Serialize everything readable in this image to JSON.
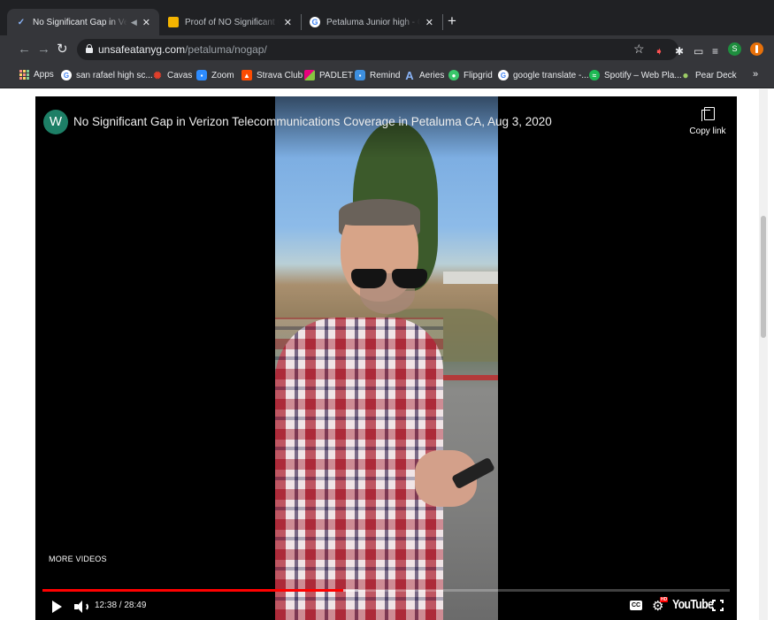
{
  "tabs": [
    {
      "title": "No Significant Gap in Verizo",
      "favicon": "checkmark-icon",
      "active": true
    },
    {
      "title": "Proof of NO Significant Gap of",
      "favicon": "slides-icon",
      "active": false
    },
    {
      "title": "Petaluma Junior high - Google",
      "favicon": "google-icon",
      "active": false
    }
  ],
  "toolbar": {
    "url_host": "unsafeatanyg.com",
    "url_path": "/petaluma/nogap/"
  },
  "bookmarks": [
    {
      "label": "Apps",
      "icon": "apps-grid-icon",
      "color": "#f28b82"
    },
    {
      "label": "san rafael high sc...",
      "icon": "google-icon",
      "color": "#4285f4"
    },
    {
      "label": "Cavas",
      "icon": "canvas-icon",
      "color": "#e13f2b"
    },
    {
      "label": "Zoom",
      "icon": "zoom-icon",
      "color": "#2d8cff"
    },
    {
      "label": "Strava Club",
      "icon": "strava-icon",
      "color": "#fc4c02"
    },
    {
      "label": "PADLET",
      "icon": "padlet-icon",
      "color": "#e6007e"
    },
    {
      "label": "Remind",
      "icon": "remind-icon",
      "color": "#3d8fe0"
    },
    {
      "label": "Aeries",
      "icon": "aeries-icon",
      "color": "#2b6cd0"
    },
    {
      "label": "Flipgrid",
      "icon": "flipgrid-icon",
      "color": "#3ac66b"
    },
    {
      "label": "google translate -...",
      "icon": "google-icon",
      "color": "#4285f4"
    },
    {
      "label": "Spotify – Web Pla...",
      "icon": "spotify-icon",
      "color": "#1db954"
    },
    {
      "label": "Pear Deck",
      "icon": "pear-deck-icon",
      "color": "#9ccc65"
    }
  ],
  "profile": {
    "initial": "S"
  },
  "video": {
    "channel_initial": "W",
    "title": "No Significant Gap in Verizon Telecommunications Coverage in Petaluma CA, Aug 3, 2020",
    "copy_link_label": "Copy link",
    "more_videos_label": "MORE VIDEOS",
    "time_display": "12:38 / 28:49",
    "played_fraction": 0.438,
    "buffered_fraction": 0.46,
    "cc_label": "CC",
    "hd_badge": "HD",
    "logo_text": "YouTube"
  },
  "colors": {
    "progress_played": "#ff0000",
    "channel_avatar": "#1d7f66",
    "chrome_dark": "#35363a"
  }
}
